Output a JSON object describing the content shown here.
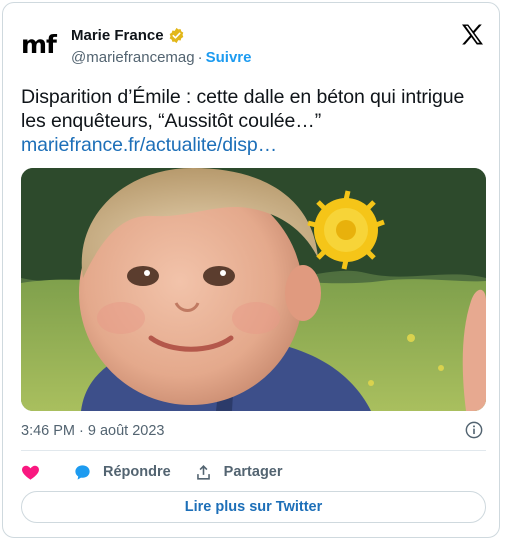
{
  "tweet": {
    "logo_text": "mf",
    "author_name": "Marie France",
    "handle": "@mariefrancemag",
    "separator": "·",
    "follow_label": "Suivre",
    "text": "Disparition d’Émile : cette dalle en béton qui intrigue les enquêteurs, “Aussitôt coulée…”",
    "link_text": "mariefrance.fr/actualite/disp…",
    "timestamp": "3:46 PM · 9 août 2023",
    "actions": {
      "like_icon": "heart-icon",
      "reply_label": "Répondre",
      "reply_icon": "speech-bubble-icon",
      "share_label": "Partager",
      "share_icon": "share-icon"
    },
    "read_more_label": "Lire plus sur Twitter"
  },
  "colors": {
    "accent_blue": "#1d9bf0",
    "link_blue": "#1d6fb8",
    "heart_pink": "#f91880",
    "verified_gold": "#e2b719",
    "secondary_text": "#536471",
    "border": "#cfd9de"
  }
}
